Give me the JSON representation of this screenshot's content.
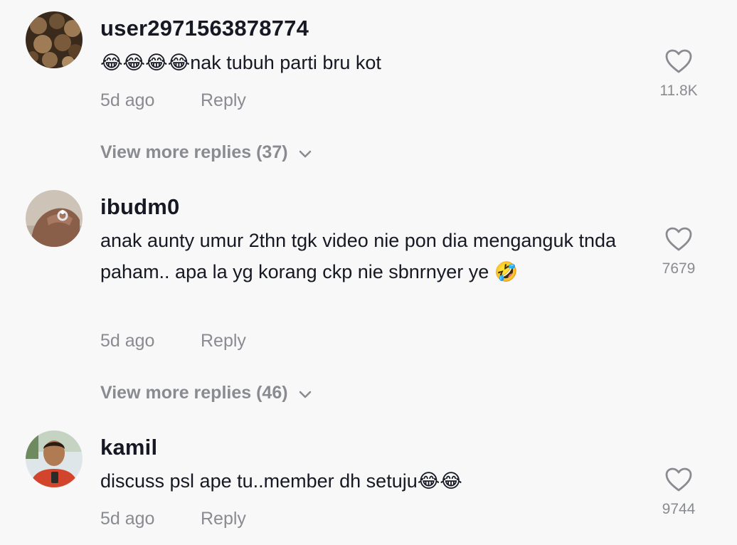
{
  "comments": [
    {
      "username": "user2971563878774",
      "text": "😂😂😂😂nak tubuh parti bru kot",
      "time": "5d ago",
      "reply_label": "Reply",
      "likes": "11.8K",
      "more_replies": "View more replies (37)"
    },
    {
      "username": "ibudm0",
      "text": "anak aunty umur 2thn tgk video nie pon dia menganguk tnda paham.. apa la yg korang ckp nie sbnrnyer ye 🤣",
      "time": "5d ago",
      "reply_label": "Reply",
      "likes": "7679",
      "more_replies": "View more replies (46)"
    },
    {
      "username": "kamil",
      "text": "discuss psl ape tu..member dh setuju😂😂",
      "time": "5d ago",
      "reply_label": "Reply",
      "likes": "9744"
    }
  ],
  "colors": {
    "background": "#f8f8f8",
    "primary_text": "#161823",
    "secondary_text": "#8a8b91"
  },
  "icons": {
    "like": "heart-outline-icon",
    "expand": "chevron-down-icon"
  }
}
